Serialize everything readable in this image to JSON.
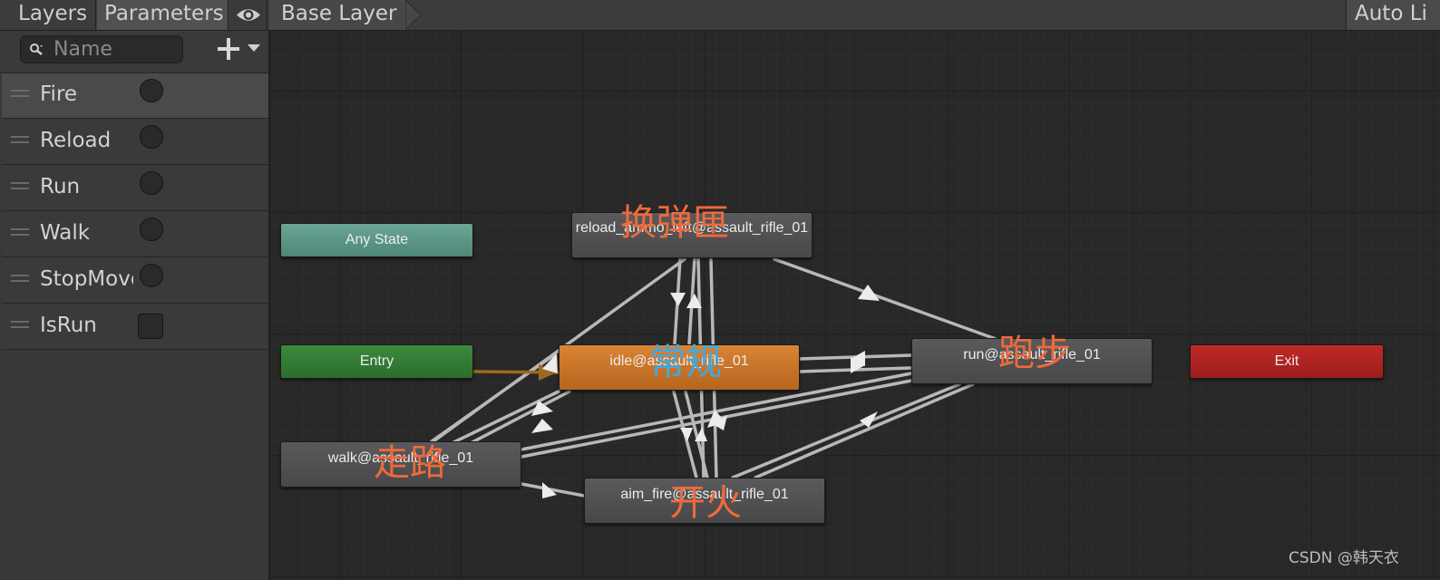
{
  "tabs": {
    "layers": "Layers",
    "parameters": "Parameters"
  },
  "breadcrumb": {
    "base_layer": "Base Layer"
  },
  "toolbar": {
    "auto_live": "Auto Li"
  },
  "search": {
    "placeholder": "Name"
  },
  "parameters": [
    {
      "name": "Fire",
      "type": "trigger"
    },
    {
      "name": "Reload",
      "type": "trigger"
    },
    {
      "name": "Run",
      "type": "trigger"
    },
    {
      "name": "Walk",
      "type": "trigger"
    },
    {
      "name": "StopMove",
      "type": "trigger"
    },
    {
      "name": "IsRun",
      "type": "bool"
    }
  ],
  "states": {
    "any_state": "Any State",
    "entry": "Entry",
    "exit": "Exit",
    "reload": "reload_ammo_left@assault_rifle_01",
    "idle": "idle@assault_rifle_01",
    "run": "run@assault_rifle_01",
    "walk": "walk@assault_rifle_01",
    "aim_fire": "aim_fire@assault_rifle_01"
  },
  "annotations": {
    "reload": "换弹匣",
    "idle": "常规",
    "run": "跑步",
    "walk": "走路",
    "aim_fire": "开火"
  },
  "colors": {
    "any_state": "#5e9a8a",
    "entry": "#347c36",
    "exit": "#ad2222",
    "default_state": "#ce7a2c",
    "state": "#505053",
    "annotation_orange": "#ef6a3a",
    "annotation_blue": "#3fa9e0",
    "entry_transition": "#9a6a1e"
  },
  "watermark": "CSDN @韩天衣"
}
